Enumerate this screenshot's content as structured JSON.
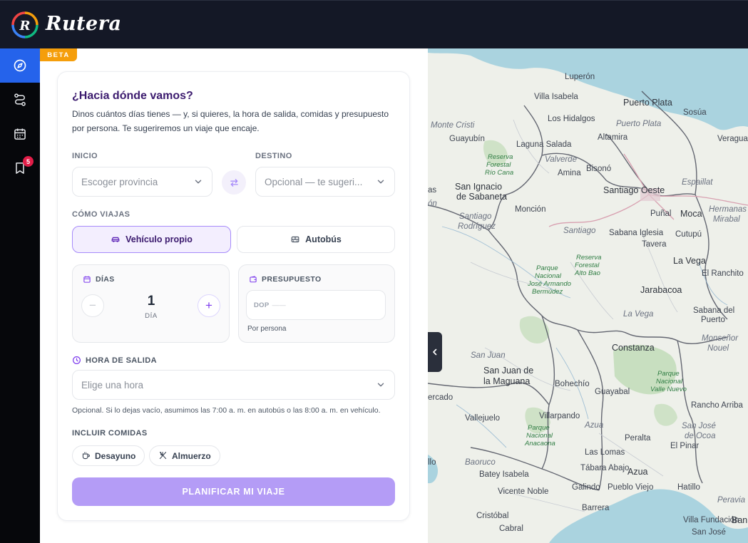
{
  "app": {
    "name": "Rutera",
    "beta_label": "BETA",
    "logo_letter": "R"
  },
  "sidebar": {
    "items": [
      {
        "name": "explore",
        "icon": "compass-icon",
        "active": true
      },
      {
        "name": "routes",
        "icon": "route-icon",
        "active": false
      },
      {
        "name": "calendar",
        "icon": "calendar-icon",
        "active": false
      },
      {
        "name": "saved",
        "icon": "bookmark-icon",
        "active": false,
        "badge": "5"
      }
    ]
  },
  "planner": {
    "title": "¿Hacia dónde vamos?",
    "subtitle": "Dinos cuántos días tienes — y, si quieres, la hora de salida, comidas y presupuesto por persona. Te sugeriremos un viaje que encaje.",
    "start": {
      "label": "INICIO",
      "placeholder": "Escoger provincia"
    },
    "destination": {
      "label": "DESTINO",
      "placeholder": "Opcional — te sugeri..."
    },
    "travel_mode": {
      "label": "CÓMO VIAJAS",
      "options": [
        {
          "label": "Vehículo propio",
          "icon": "car-icon",
          "selected": true
        },
        {
          "label": "Autobús",
          "icon": "bus-icon",
          "selected": false
        }
      ]
    },
    "days": {
      "label": "DÍAS",
      "value": "1",
      "unit": "DÍA",
      "minus": "−",
      "plus": "+"
    },
    "budget": {
      "label": "PRESUPUESTO",
      "currency": "DOP",
      "placeholder": "——",
      "note": "Por persona"
    },
    "departure": {
      "label": "HORA DE SALIDA",
      "placeholder": "Elige una hora",
      "hint": "Opcional. Si lo dejas vacío, asumimos las 7:00 a. m. en autobús o las 8:00 a. m. en vehículo."
    },
    "meals": {
      "label": "INCLUIR COMIDAS",
      "options": [
        {
          "label": "Desayuno",
          "icon": "coffee-icon"
        },
        {
          "label": "Almuerzo",
          "icon": "utensils-icon"
        }
      ]
    },
    "submit_label": "PLANIFICAR MI VIAJE"
  },
  "map": {
    "labels": {
      "luperon": "Luperón",
      "villa_isabela": "Villa Isabela",
      "puerto_plata": "Puerto Plata",
      "sosua": "Sosúa",
      "monte_cristi": "Monte Cristi",
      "guayubin": "Guayubín",
      "los_hidalgos": "Los Hidalgos",
      "puerto_plata_prov": "Puerto Plata",
      "altamira": "Altamira",
      "veragua": "Veragua",
      "laguna_salada": "Laguna Salada",
      "reserva_rio_cana_1": "Reserva",
      "reserva_rio_cana_2": "Forestal",
      "reserva_rio_cana_3": "Río Cana",
      "valverde": "Valverde",
      "amina": "Amina",
      "bisono": "Bisonó",
      "espaillat": "Espaillat",
      "san_ignacio_1": "San Ignacio",
      "san_ignacio_2": "de Sabaneta",
      "santiago_oeste": "Santiago Oeste",
      "hermanas_1": "Hermanas",
      "hermanas_2": "Mirabal",
      "moncion": "Monción",
      "punal": "Puñal",
      "moca": "Moca",
      "santiago_rodriguez_1": "Santiago",
      "santiago_rodriguez_2": "Rodríguez",
      "santiago_prov": "Santiago",
      "sabana_iglesia": "Sabana Iglesia",
      "cutupu": "Cutupú",
      "tavera": "Tavera",
      "reserva_alto_bao_1": "Reserva",
      "reserva_alto_bao_2": "Forestal",
      "reserva_alto_bao_3": "Alto Bao",
      "la_vega_city": "La Vega",
      "parque_armando_1": "Parque",
      "parque_armando_2": "Nacional",
      "parque_armando_3": "José Armando",
      "parque_armando_4": "Bermúdez",
      "el_ranchito": "El Ranchito",
      "jarabacoa": "Jarabacoa",
      "sabana_puerto_1": "Sabana del",
      "sabana_puerto_2": "Puerto",
      "la_vega_prov": "La Vega",
      "monsenor_1": "Monseñor",
      "monsenor_2": "Nouel",
      "san_juan_prov": "San Juan",
      "constanza": "Constanza",
      "san_juan_maguana_1": "San Juan de",
      "san_juan_maguana_2": "la Maguana",
      "bohechio": "Bohechío",
      "parque_valle_nuevo_1": "Parque",
      "parque_valle_nuevo_2": "Nacional",
      "parque_valle_nuevo_3": "Valle Nuevo",
      "guayabal": "Guayabal",
      "cercado": "ercado",
      "rancho_arriba": "Rancho Arriba",
      "vallejuelo": "Vallejuelo",
      "villarpando": "Villarpando",
      "azua_prov": "Azua",
      "san_jose_ocoa_1": "San José",
      "san_jose_ocoa_2": "de Ocoa",
      "parque_anacaona_1": "Parque",
      "parque_anacaona_2": "Nacional",
      "parque_anacaona_3": "Anacaona",
      "peralta": "Peralta",
      "el_pinar": "El Pinar",
      "baoruco": "Baoruco",
      "las_lomas": "Las Lomas",
      "batey_isabela": "Batey Isabela",
      "tabara_abajo": "Tábara Abajo",
      "azua_city": "Azua",
      "vicente_noble": "Vicente Noble",
      "galindo": "Galindo",
      "pueblo_viejo": "Pueblo Viejo",
      "hatillo": "Hatillo",
      "peravia": "Peravia",
      "barrera": "Barrera",
      "cristobal": "Cristóbal",
      "villa_fundacion": "Villa Fundación",
      "cabral": "Cabral",
      "san_jose": "San José",
      "ban": "Ban",
      "mon_left": "ón",
      "as_left": "as",
      "llo_left": "llo"
    }
  },
  "colors": {
    "topbar": "#141826",
    "sidebar": "#06070b",
    "sidebar_active": "#2563eb",
    "accent": "#7c3aed",
    "title": "#3b1a6e",
    "cta": "#b49cf6",
    "beta": "#f59e0b",
    "badge": "#e11d48",
    "water": "#aad3df"
  }
}
